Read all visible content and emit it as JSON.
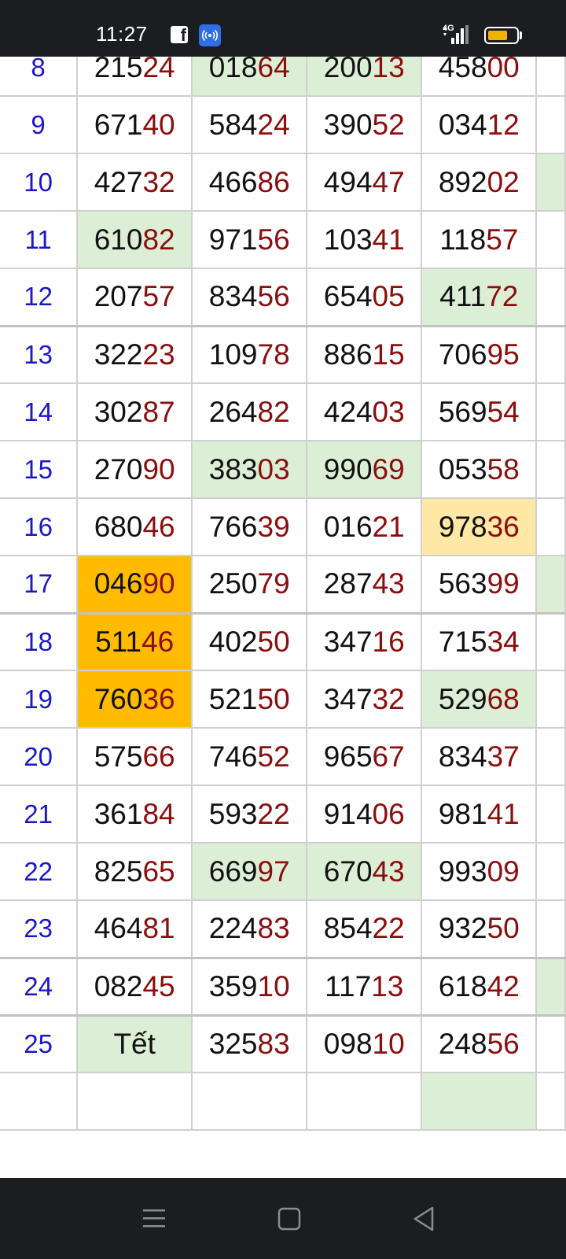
{
  "status_bar": {
    "time": "11:27",
    "network_label": "4G",
    "battery_level": 0.7,
    "icons": [
      "facebook-icon",
      "hotspot-icon",
      "signal-icon",
      "battery-icon"
    ]
  },
  "colors": {
    "day_number": "#1a17c8",
    "digits_main": "#111111",
    "digits_tail": "#8b0d0d",
    "green_highlight": "#dcefd6",
    "orange_highlight": "#ffbb00",
    "yellow_highlight": "#ffe7a6"
  },
  "rows": [
    {
      "day": "8",
      "cells": [
        {
          "head": "215",
          "tail": "24"
        },
        {
          "head": "018",
          "tail": "64",
          "hl": "green"
        },
        {
          "head": "200",
          "tail": "13",
          "hl": "green"
        },
        {
          "head": "458",
          "tail": "00"
        }
      ],
      "edge": ""
    },
    {
      "day": "9",
      "cells": [
        {
          "head": "671",
          "tail": "40"
        },
        {
          "head": "584",
          "tail": "24"
        },
        {
          "head": "390",
          "tail": "52"
        },
        {
          "head": "034",
          "tail": "12"
        }
      ],
      "edge": ""
    },
    {
      "day": "10",
      "cells": [
        {
          "head": "427",
          "tail": "32"
        },
        {
          "head": "466",
          "tail": "86"
        },
        {
          "head": "494",
          "tail": "47"
        },
        {
          "head": "892",
          "tail": "02"
        }
      ],
      "edge": "green"
    },
    {
      "day": "11",
      "cells": [
        {
          "head": "610",
          "tail": "82",
          "hl": "green"
        },
        {
          "head": "971",
          "tail": "56"
        },
        {
          "head": "103",
          "tail": "41"
        },
        {
          "head": "118",
          "tail": "57"
        }
      ],
      "edge": ""
    },
    {
      "day": "12",
      "cells": [
        {
          "head": "207",
          "tail": "57"
        },
        {
          "head": "834",
          "tail": "56"
        },
        {
          "head": "654",
          "tail": "05"
        },
        {
          "head": "411",
          "tail": "72",
          "hl": "green"
        }
      ],
      "edge": ""
    },
    {
      "day": "13",
      "cells": [
        {
          "head": "322",
          "tail": "23"
        },
        {
          "head": "109",
          "tail": "78"
        },
        {
          "head": "886",
          "tail": "15"
        },
        {
          "head": "706",
          "tail": "95"
        }
      ],
      "edge": ""
    },
    {
      "day": "14",
      "cells": [
        {
          "head": "302",
          "tail": "87"
        },
        {
          "head": "264",
          "tail": "82"
        },
        {
          "head": "424",
          "tail": "03"
        },
        {
          "head": "569",
          "tail": "54"
        }
      ],
      "edge": ""
    },
    {
      "day": "15",
      "cells": [
        {
          "head": "270",
          "tail": "90"
        },
        {
          "head": "383",
          "tail": "03",
          "hl": "green"
        },
        {
          "head": "990",
          "tail": "69",
          "hl": "green"
        },
        {
          "head": "053",
          "tail": "58"
        }
      ],
      "edge": ""
    },
    {
      "day": "16",
      "cells": [
        {
          "head": "680",
          "tail": "46"
        },
        {
          "head": "766",
          "tail": "39"
        },
        {
          "head": "016",
          "tail": "21"
        },
        {
          "head": "978",
          "tail": "36",
          "hl": "yellow"
        }
      ],
      "edge": ""
    },
    {
      "day": "17",
      "cells": [
        {
          "head": "046",
          "tail": "90",
          "hl": "orange"
        },
        {
          "head": "250",
          "tail": "79"
        },
        {
          "head": "287",
          "tail": "43"
        },
        {
          "head": "563",
          "tail": "99"
        }
      ],
      "edge": "green"
    },
    {
      "day": "18",
      "cells": [
        {
          "head": "511",
          "tail": "46",
          "hl": "orange"
        },
        {
          "head": "402",
          "tail": "50"
        },
        {
          "head": "347",
          "tail": "16"
        },
        {
          "head": "715",
          "tail": "34"
        }
      ],
      "edge": ""
    },
    {
      "day": "19",
      "cells": [
        {
          "head": "760",
          "tail": "36",
          "hl": "orange"
        },
        {
          "head": "521",
          "tail": "50"
        },
        {
          "head": "347",
          "tail": "32"
        },
        {
          "head": "529",
          "tail": "68",
          "hl": "green"
        }
      ],
      "edge": ""
    },
    {
      "day": "20",
      "cells": [
        {
          "head": "575",
          "tail": "66"
        },
        {
          "head": "746",
          "tail": "52"
        },
        {
          "head": "965",
          "tail": "67"
        },
        {
          "head": "834",
          "tail": "37"
        }
      ],
      "edge": ""
    },
    {
      "day": "21",
      "cells": [
        {
          "head": "361",
          "tail": "84"
        },
        {
          "head": "593",
          "tail": "22"
        },
        {
          "head": "914",
          "tail": "06"
        },
        {
          "head": "981",
          "tail": "41"
        }
      ],
      "edge": ""
    },
    {
      "day": "22",
      "cells": [
        {
          "head": "825",
          "tail": "65"
        },
        {
          "head": "669",
          "tail": "97",
          "hl": "green"
        },
        {
          "head": "670",
          "tail": "43",
          "hl": "green"
        },
        {
          "head": "993",
          "tail": "09"
        }
      ],
      "edge": ""
    },
    {
      "day": "23",
      "cells": [
        {
          "head": "464",
          "tail": "81"
        },
        {
          "head": "224",
          "tail": "83"
        },
        {
          "head": "854",
          "tail": "22"
        },
        {
          "head": "932",
          "tail": "50"
        }
      ],
      "edge": ""
    },
    {
      "day": "24",
      "cells": [
        {
          "head": "082",
          "tail": "45"
        },
        {
          "head": "359",
          "tail": "10"
        },
        {
          "head": "117",
          "tail": "13"
        },
        {
          "head": "618",
          "tail": "42"
        }
      ],
      "edge": "green"
    },
    {
      "day": "25",
      "cells": [
        {
          "text": "Tết",
          "hl": "green"
        },
        {
          "head": "325",
          "tail": "83"
        },
        {
          "head": "098",
          "tail": "10"
        },
        {
          "head": "248",
          "tail": "56"
        }
      ],
      "edge": ""
    }
  ],
  "navbar": {
    "icons": [
      "menu-icon",
      "home-square-icon",
      "back-triangle-icon"
    ]
  }
}
